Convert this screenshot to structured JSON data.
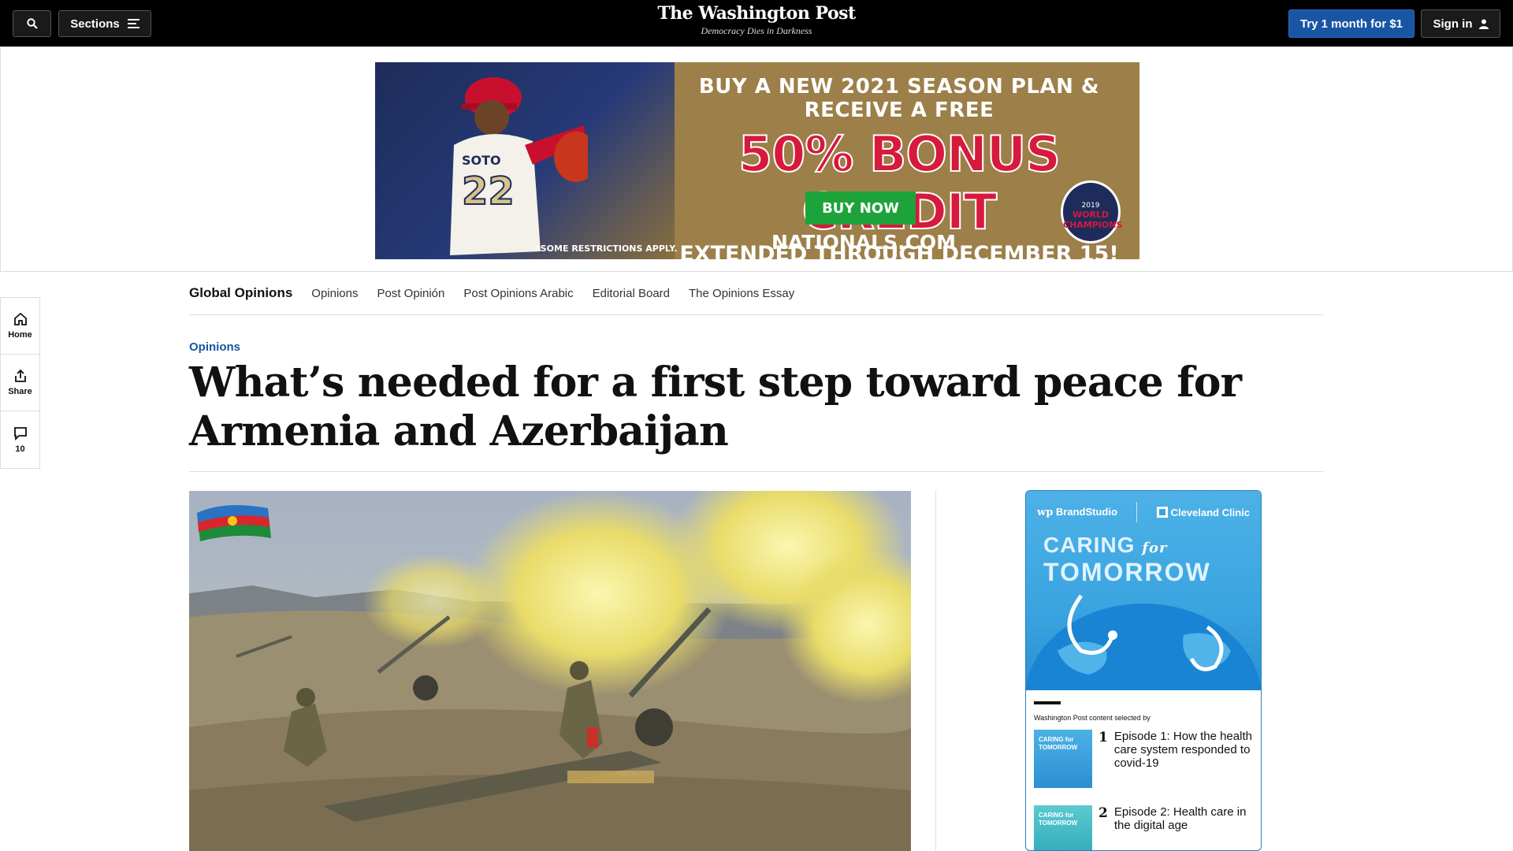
{
  "topbar": {
    "sections_label": "Sections",
    "logo": "The Washington Post",
    "tagline": "Democracy Dies in Darkness",
    "trial_label": "Try 1 month for $1",
    "signin_label": "Sign in"
  },
  "ad": {
    "line1": "BUY A NEW 2021 SEASON PLAN & RECEIVE A FREE",
    "line2": "50% BONUS CREDIT",
    "line3": "EXTENDED THROUGH DECEMBER 15!",
    "button": "BUY NOW",
    "site": "NATIONALS.COM",
    "restrictions": "*SOME RESTRICTIONS APPLY.",
    "badge_year": "2019",
    "badge_text": "WORLD CHAMPIONS",
    "jersey_name": "SOTO",
    "jersey_number": "22"
  },
  "subnav": {
    "brand": "Global Opinions",
    "items": [
      "Opinions",
      "Post Opinión",
      "Post Opinions Arabic",
      "Editorial Board",
      "The Opinions Essay"
    ]
  },
  "rail": {
    "home": "Home",
    "share": "Share",
    "comments": "10"
  },
  "article": {
    "kicker": "Opinions",
    "headline": "What’s needed for a first step toward peace for Armenia and Azerbaijan"
  },
  "brandstudio": {
    "wp_label": "BrandStudio",
    "partner": "Cleveland Clinic",
    "title_1a": "CARING",
    "title_1b": "for",
    "title_2": "TOMORROW",
    "selected_by": "Washington Post content selected by",
    "items": [
      {
        "num": "1",
        "text": "Episode 1: How the health care system responded to covid-19",
        "thumb": "CARING for TOMORROW"
      },
      {
        "num": "2",
        "text": "Episode 2: Health care in the digital age",
        "thumb": "CARING for TOMORROW"
      }
    ]
  },
  "colors": {
    "accent_blue": "#1955a5",
    "topbar": "#000000",
    "ad_gold": "#9c7f49",
    "ad_red": "#d7193b",
    "brandstudio_blue": "#3aa4e0"
  }
}
